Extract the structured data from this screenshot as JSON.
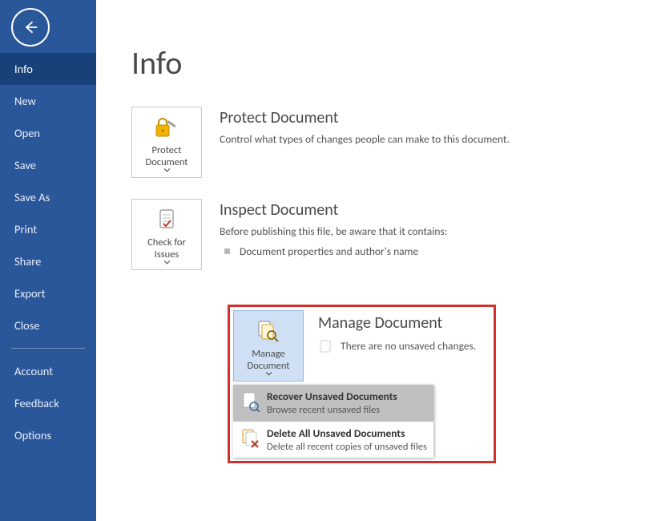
{
  "sidebar": {
    "items": [
      {
        "label": "Info",
        "selected": true
      },
      {
        "label": "New"
      },
      {
        "label": "Open"
      },
      {
        "label": "Save"
      },
      {
        "label": "Save As"
      },
      {
        "label": "Print"
      },
      {
        "label": "Share"
      },
      {
        "label": "Export"
      },
      {
        "label": "Close"
      }
    ],
    "footer": [
      {
        "label": "Account"
      },
      {
        "label": "Feedback"
      },
      {
        "label": "Options"
      }
    ]
  },
  "page_title": "Info",
  "sections": {
    "protect": {
      "tile_label": "Protect Document",
      "title": "Protect Document",
      "desc": "Control what types of changes people can make to this document."
    },
    "inspect": {
      "tile_label": "Check for Issues",
      "title": "Inspect Document",
      "desc": "Before publishing this file, be aware that it contains:",
      "bullet": "Document properties and author's name"
    },
    "manage": {
      "tile_label": "Manage Document",
      "title": "Manage Document",
      "status": "There are no unsaved changes.",
      "menu": [
        {
          "title": "Recover Unsaved Documents",
          "sub": "Browse recent unsaved files",
          "selected": true
        },
        {
          "title": "Delete All Unsaved Documents",
          "sub": "Delete all recent copies of unsaved files"
        }
      ]
    }
  }
}
